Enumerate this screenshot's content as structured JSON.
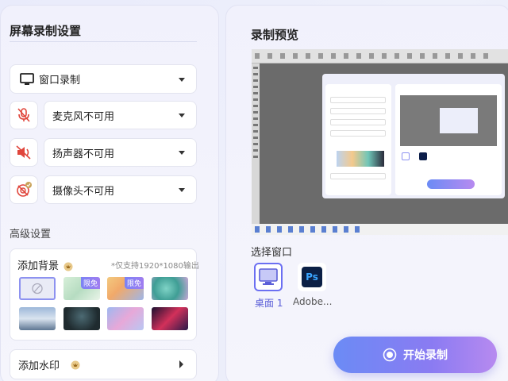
{
  "left": {
    "title": "屏幕录制设置",
    "window_record": "窗口录制",
    "microphone": "麦克风不可用",
    "speaker": "扬声器不可用",
    "camera": "摄像头不可用",
    "advanced_title": "高级设置",
    "background": {
      "title": "添加背景",
      "note": "*仅支持1920*1080输出",
      "badge": "限免"
    },
    "watermark": "添加水印"
  },
  "right": {
    "title": "录制预览",
    "select_window": "选择窗口",
    "windows": [
      {
        "label": "桌面 1",
        "icon": "monitor-icon"
      },
      {
        "label": "Adobe...",
        "icon": "photoshop-icon",
        "icon_text": "Ps"
      }
    ],
    "start_button": "开始录制"
  },
  "colors": {
    "accent": "#5b6cf0",
    "danger": "#e0463c",
    "vip_gold": "#c9a35a"
  }
}
